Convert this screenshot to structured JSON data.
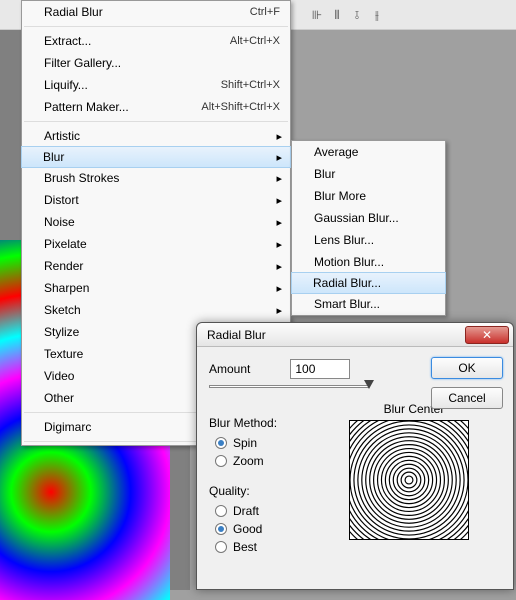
{
  "menu": {
    "items": [
      {
        "label": "Radial Blur",
        "shortcut": "Ctrl+F"
      },
      {
        "label": "Extract...",
        "shortcut": "Alt+Ctrl+X"
      },
      {
        "label": "Filter Gallery...",
        "shortcut": ""
      },
      {
        "label": "Liquify...",
        "shortcut": "Shift+Ctrl+X"
      },
      {
        "label": "Pattern Maker...",
        "shortcut": "Alt+Shift+Ctrl+X"
      }
    ],
    "filters": [
      {
        "label": "Artistic"
      },
      {
        "label": "Blur"
      },
      {
        "label": "Brush Strokes"
      },
      {
        "label": "Distort"
      },
      {
        "label": "Noise"
      },
      {
        "label": "Pixelate"
      },
      {
        "label": "Render"
      },
      {
        "label": "Sharpen"
      },
      {
        "label": "Sketch"
      },
      {
        "label": "Stylize"
      },
      {
        "label": "Texture"
      },
      {
        "label": "Video"
      },
      {
        "label": "Other"
      }
    ],
    "bottom": [
      {
        "label": "Digimarc"
      }
    ]
  },
  "submenu": {
    "items": [
      "Average",
      "Blur",
      "Blur More",
      "Gaussian Blur...",
      "Lens Blur...",
      "Motion Blur...",
      "Radial Blur...",
      "Smart Blur..."
    ]
  },
  "dialog": {
    "title": "Radial Blur",
    "amount_label": "Amount",
    "amount_value": "100",
    "blur_method_label": "Blur Method:",
    "method_spin": "Spin",
    "method_zoom": "Zoom",
    "quality_label": "Quality:",
    "quality_draft": "Draft",
    "quality_good": "Good",
    "quality_best": "Best",
    "blur_center_label": "Blur Center",
    "ok": "OK",
    "cancel": "Cancel"
  }
}
